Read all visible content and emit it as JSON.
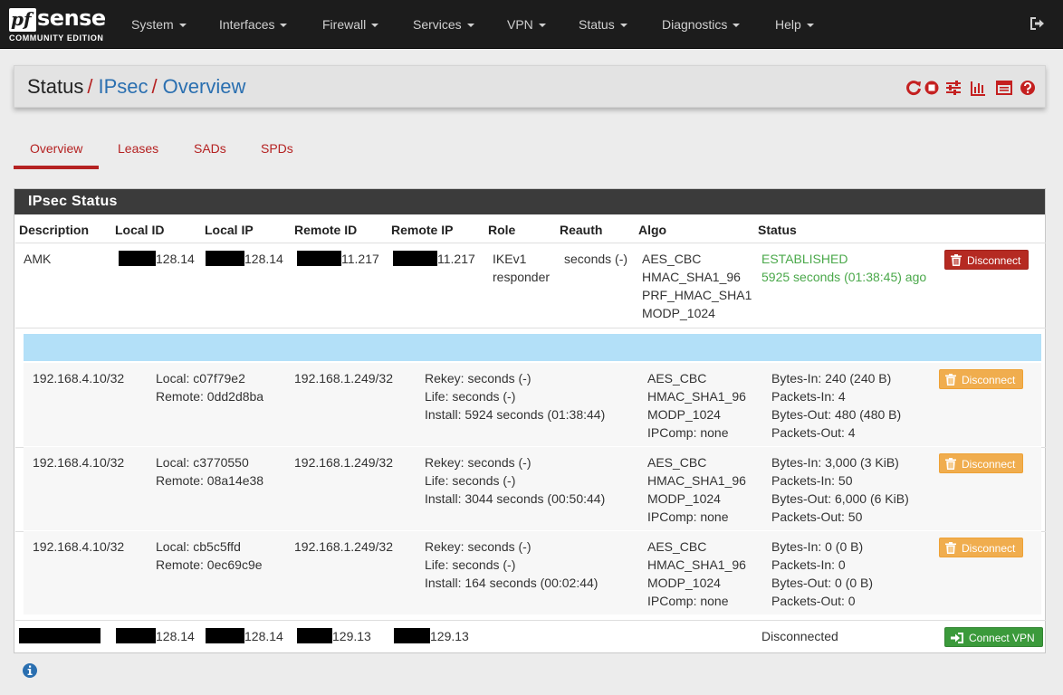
{
  "brand": {
    "pf": "pf",
    "name": "sense",
    "edition": "COMMUNITY EDITION"
  },
  "nav": [
    "System",
    "Interfaces",
    "Firewall",
    "Services",
    "VPN",
    "Status",
    "Diagnostics",
    "Help"
  ],
  "breadcrumb": {
    "root": "Status",
    "sep": "/",
    "section": "IPsec",
    "page": "Overview"
  },
  "header_icons": [
    "restart-service-icon",
    "stop-service-icon",
    "settings-sliders-icon",
    "bar-chart-icon",
    "log-list-icon",
    "help-icon"
  ],
  "tabs": [
    "Overview",
    "Leases",
    "SADs",
    "SPDs"
  ],
  "active_tab": "Overview",
  "panel": {
    "title": "IPsec Status",
    "columns": [
      "Description",
      "Local ID",
      "Local IP",
      "Remote ID",
      "Remote IP",
      "Role",
      "Reauth",
      "Algo",
      "Status"
    ]
  },
  "tunnel": {
    "description": "AMK",
    "local_id": "128.14",
    "local_ip": "128.14",
    "remote_id": "11.217",
    "remote_ip": "11.217",
    "role": [
      "IKEv1",
      "responder"
    ],
    "reauth": "seconds (-)",
    "algo": [
      "AES_CBC",
      "HMAC_SHA1_96",
      "PRF_HMAC_SHA1",
      "MODP_1024"
    ],
    "status": "ESTABLISHED",
    "established": "5925 seconds (01:38:45) ago",
    "button": "Disconnect"
  },
  "children": [
    {
      "local_net": "192.168.4.10/32",
      "spi": [
        "Local: c07f79e2",
        "Remote: 0dd2d8ba"
      ],
      "remote_net": "192.168.1.249/32",
      "times": [
        "Rekey: seconds (-)",
        "Life: seconds (-)",
        "Install: 5924 seconds (01:38:44)"
      ],
      "algo": [
        "AES_CBC",
        "HMAC_SHA1_96",
        "MODP_1024",
        "IPComp: none"
      ],
      "stats": [
        "Bytes-In: 240 (240 B)",
        "Packets-In: 4",
        "Bytes-Out: 480 (480 B)",
        "Packets-Out: 4"
      ],
      "button": "Disconnect"
    },
    {
      "local_net": "192.168.4.10/32",
      "spi": [
        "Local: c3770550",
        "Remote: 08a14e38"
      ],
      "remote_net": "192.168.1.249/32",
      "times": [
        "Rekey: seconds (-)",
        "Life: seconds (-)",
        "Install: 3044 seconds (00:50:44)"
      ],
      "algo": [
        "AES_CBC",
        "HMAC_SHA1_96",
        "MODP_1024",
        "IPComp: none"
      ],
      "stats": [
        "Bytes-In: 3,000 (3 KiB)",
        "Packets-In: 50",
        "Bytes-Out: 6,000 (6 KiB)",
        "Packets-Out: 50"
      ],
      "button": "Disconnect"
    },
    {
      "local_net": "192.168.4.10/32",
      "spi": [
        "Local: cb5c5ffd",
        "Remote: 0ec69c9e"
      ],
      "remote_net": "192.168.1.249/32",
      "times": [
        "Rekey: seconds (-)",
        "Life: seconds (-)",
        "Install: 164 seconds (00:02:44)"
      ],
      "algo": [
        "AES_CBC",
        "HMAC_SHA1_96",
        "MODP_1024",
        "IPComp: none"
      ],
      "stats": [
        "Bytes-In: 0 (0 B)",
        "Packets-In: 0",
        "Bytes-Out: 0 (0 B)",
        "Packets-Out: 0"
      ],
      "button": "Disconnect"
    }
  ],
  "disconnected": {
    "local_id": "128.14",
    "local_ip": "128.14",
    "remote_id": "129.13",
    "remote_ip": "129.13",
    "status": "Disconnected",
    "button": "Connect VPN"
  },
  "colors": {
    "navbar": "#1c1c1c",
    "accent_red": "#b52222",
    "link_blue": "#2a6fb0",
    "established_green": "#4aa84a",
    "child_highlight": "#b3e0f8",
    "warning_orange": "#f0ad4e",
    "success_green": "#3b9a3b"
  }
}
